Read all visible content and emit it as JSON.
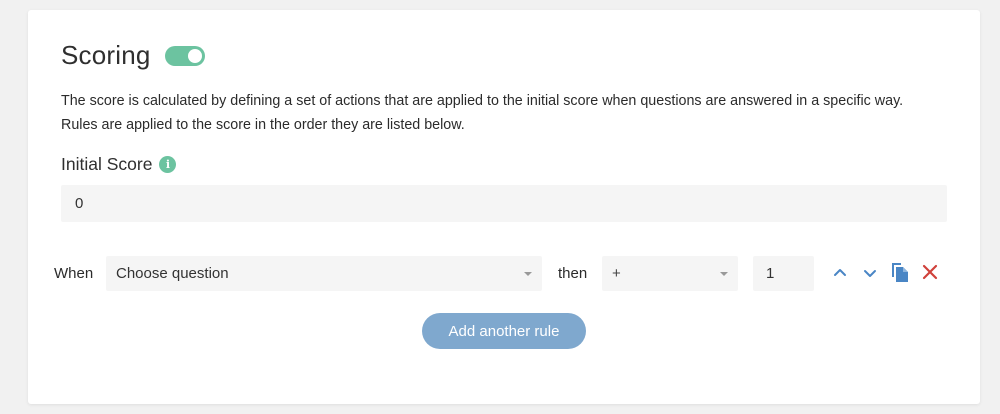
{
  "scoring": {
    "title": "Scoring",
    "enabled": true,
    "description": "The score is calculated by defining a set of actions that are applied to the initial score when questions are answered in a specific way. Rules are applied to the score in the order they are listed below.",
    "initial_score_label": "Initial Score",
    "info_icon": "info-icon",
    "initial_score_value": "0"
  },
  "rule": {
    "when_label": "When",
    "question_placeholder": "Choose question",
    "then_label": "then",
    "operator": "+",
    "amount": "1",
    "icons": [
      "chevron-up-icon",
      "chevron-down-icon",
      "copy-icon",
      "delete-icon"
    ]
  },
  "actions": {
    "add_rule_label": "Add another rule"
  },
  "colors": {
    "accent_green": "#6cc3a0",
    "icon_blue": "#4a86c5",
    "delete_red": "#d0413b",
    "button_blue": "#7fa8ce"
  }
}
